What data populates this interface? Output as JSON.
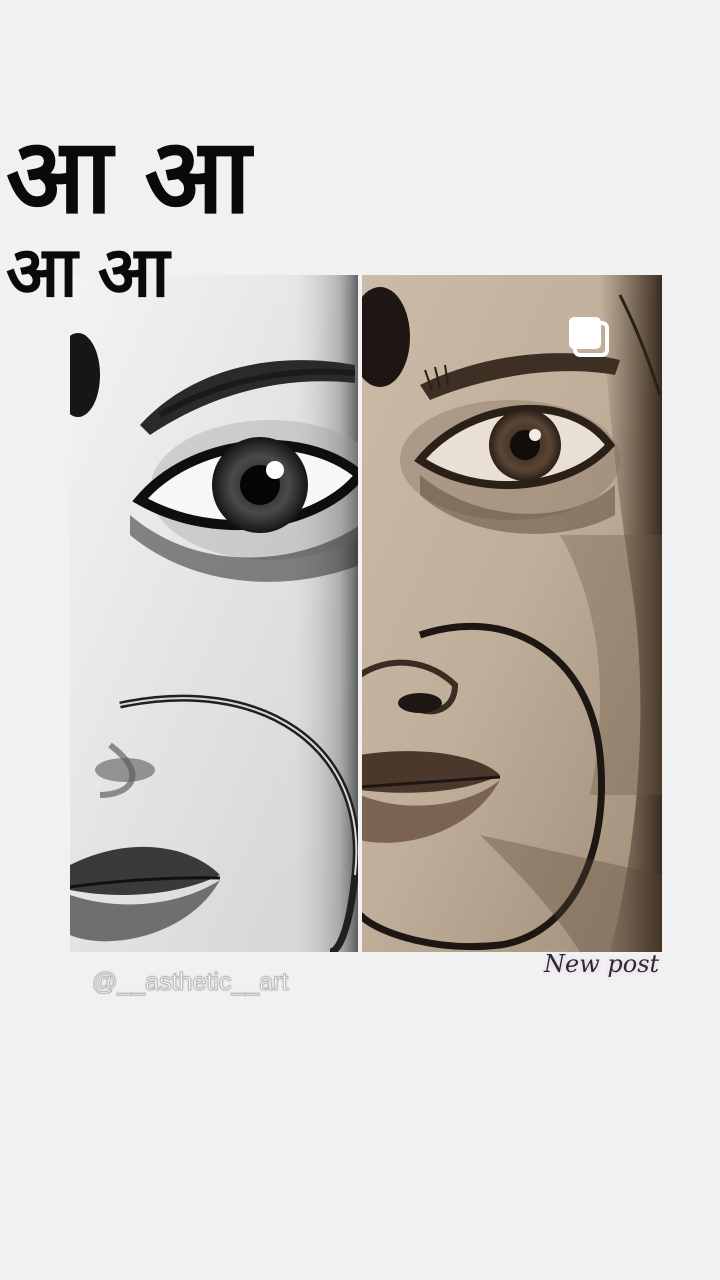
{
  "title": {
    "line1": "आ आ",
    "line2": "आ आ"
  },
  "post": {
    "watermark": "@__asthetic__art",
    "badge": "New post",
    "left_panel": "photo-portrait",
    "right_panel": "sketch-portrait"
  },
  "icons": {
    "multiple_posts": "multiple-images-icon"
  },
  "colors": {
    "background": "#f2f1f1",
    "title_text": "#0a0a0a",
    "sketch_tone": "#c7b7a4"
  }
}
